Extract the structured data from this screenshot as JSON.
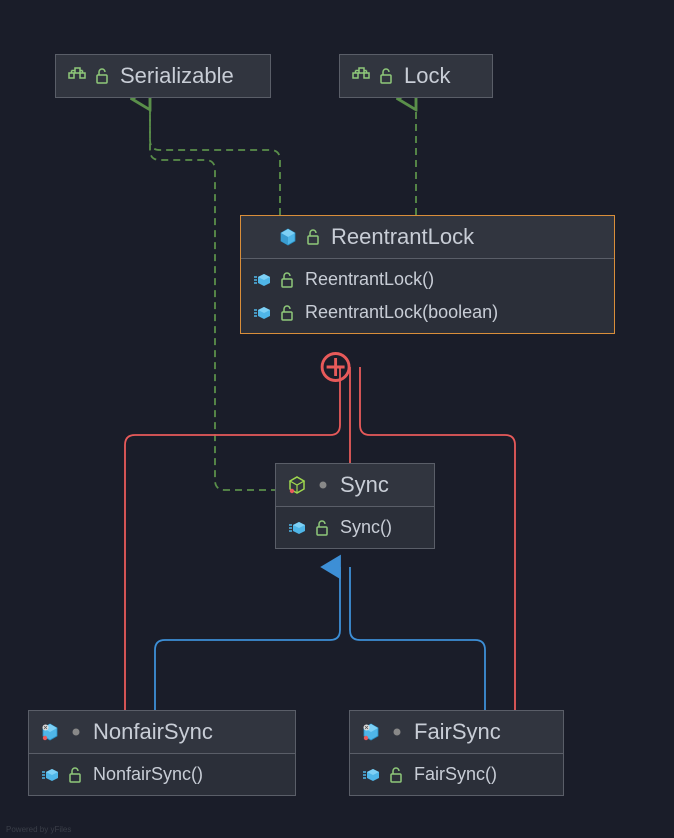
{
  "nodes": {
    "serializable": {
      "label": "Serializable"
    },
    "lock": {
      "label": "Lock"
    },
    "reentrantLock": {
      "label": "ReentrantLock",
      "methods": [
        "ReentrantLock()",
        "ReentrantLock(boolean)"
      ]
    },
    "sync": {
      "label": "Sync",
      "methods": [
        "Sync()"
      ]
    },
    "nonfairSync": {
      "label": "NonfairSync",
      "methods": [
        "NonfairSync()"
      ]
    },
    "fairSync": {
      "label": "FairSync",
      "methods": [
        "FairSync()"
      ]
    }
  },
  "iconNames": {
    "interface": "interface-icon",
    "class": "class-icon",
    "abstractClass": "abstract-class-icon",
    "staticClass": "static-class-icon",
    "method": "method-icon",
    "unlock": "unlock-icon",
    "dot": "modifier-dot-icon"
  },
  "watermark": "Powered by yFiles",
  "relationships": [
    {
      "from": "ReentrantLock",
      "to": "Serializable",
      "type": "implements"
    },
    {
      "from": "ReentrantLock",
      "to": "Lock",
      "type": "implements"
    },
    {
      "from": "Sync",
      "to": "Serializable",
      "type": "implements"
    },
    {
      "from": "Sync",
      "to": "ReentrantLock",
      "type": "inner"
    },
    {
      "from": "NonfairSync",
      "to": "Sync",
      "type": "extends"
    },
    {
      "from": "FairSync",
      "to": "Sync",
      "type": "extends"
    },
    {
      "from": "NonfairSync",
      "to": "ReentrantLock",
      "type": "inner"
    },
    {
      "from": "FairSync",
      "to": "ReentrantLock",
      "type": "inner"
    }
  ]
}
